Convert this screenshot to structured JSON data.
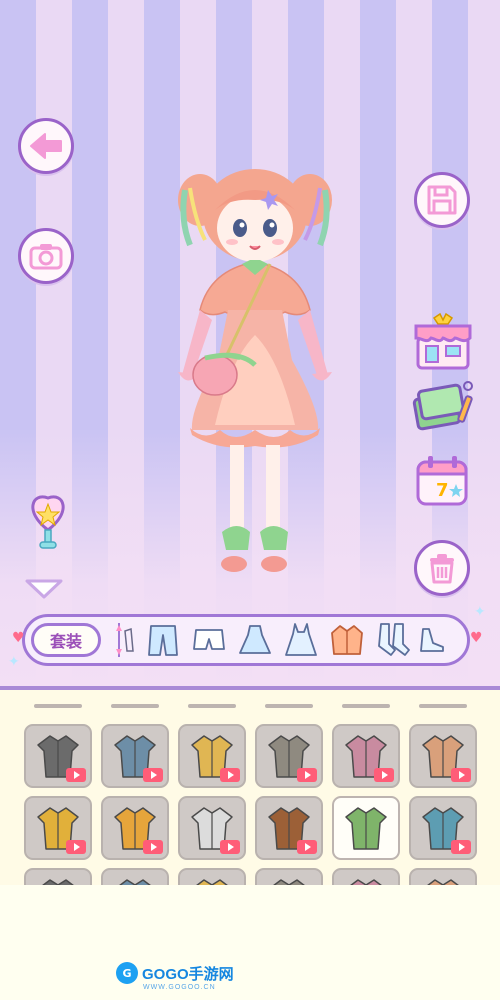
{
  "toolbar": {
    "category_label": "套装",
    "tools": [
      {
        "name": "adjust-icon"
      },
      {
        "name": "pants-icon"
      },
      {
        "name": "shorts-icon"
      },
      {
        "name": "skirt-icon"
      },
      {
        "name": "dress-icon"
      },
      {
        "name": "jacket-icon"
      },
      {
        "name": "socks-icon"
      },
      {
        "name": "shoes-icon"
      }
    ]
  },
  "left_buttons": [
    "back-icon",
    "camera-icon",
    "magic-wand-icon",
    "collapse-arrow-icon"
  ],
  "right_buttons": [
    "save-icon",
    "shop-icon",
    "wardrobe-book-icon",
    "daily-calendar-icon",
    "delete-icon"
  ],
  "calendar_day": "7",
  "items": [
    {
      "name": "plaid-shirt",
      "color": "#6b6b6b",
      "video": true
    },
    {
      "name": "denim-cardigan",
      "color": "#6d8ea7",
      "video": true
    },
    {
      "name": "yellow-cardigan",
      "color": "#e0b653",
      "video": true
    },
    {
      "name": "plaid-coat",
      "color": "#8f8a80",
      "video": true
    },
    {
      "name": "pink-puffer",
      "color": "#c98ba0",
      "video": true
    },
    {
      "name": "tan-sweatshirt",
      "color": "#d9a07b",
      "video": true
    },
    {
      "name": "yellow-hoodie",
      "color": "#e1b03a",
      "video": true
    },
    {
      "name": "mustard-top",
      "color": "#e6a53b",
      "video": true
    },
    {
      "name": "white-blazer",
      "color": "#dcdcdc",
      "video": true
    },
    {
      "name": "brown-jacket",
      "color": "#9c6037",
      "video": true
    },
    {
      "name": "green-hoodie",
      "color": "#7fb46a",
      "video": false,
      "selected": true
    },
    {
      "name": "teal-jacket",
      "color": "#5d9db2",
      "video": true
    }
  ],
  "watermark": {
    "logo": "G",
    "text": "GOGO手游网",
    "sub": "WWW.GOGOO.CN"
  }
}
